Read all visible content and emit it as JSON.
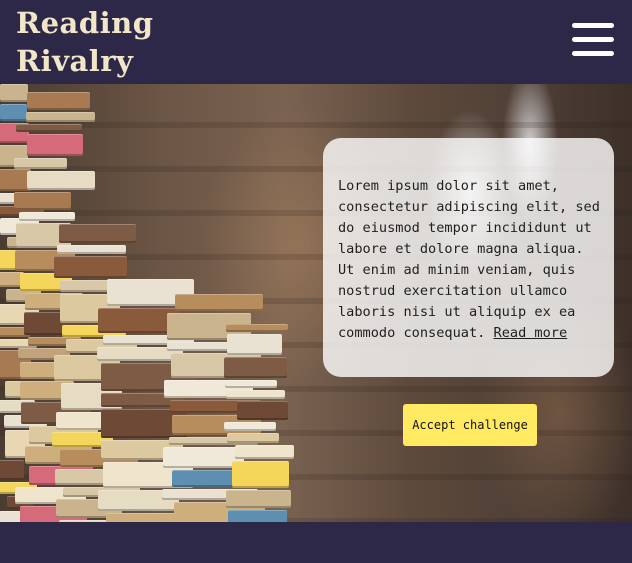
{
  "header": {
    "logo_line1": "Reading",
    "logo_line2": "Rivalry",
    "menu_icon": "hamburger-menu-icon"
  },
  "hero": {
    "image": "library-books-photo",
    "body_text": "Lorem ipsum dolor sit amet, consectetur adipiscing elit, sed do eiusmod tempor incididunt ut labore et dolore magna aliqua. Ut enim ad minim veniam, quis nostrud exercitation ullamco laboris nisi ut aliquip ex ea commodo consequat.",
    "read_more": "Read more",
    "cta_label": "Accept challenge"
  },
  "colors": {
    "brand_bg": "#2e2848",
    "logo": "#f1e7c8",
    "cta": "#ffea62"
  }
}
